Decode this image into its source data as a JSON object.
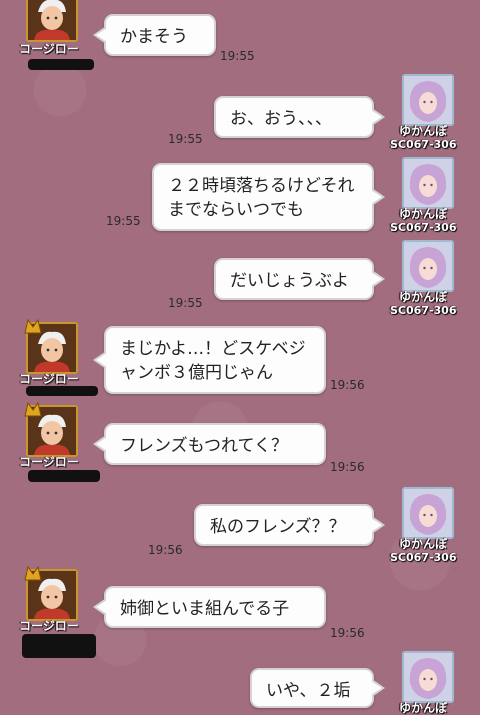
{
  "participants": {
    "kojiro": {
      "name": "コージロー"
    },
    "yukanbo": {
      "name": "ゆかんぼ",
      "code": "SC067-306"
    }
  },
  "messages": [
    {
      "sender": "kojiro",
      "text": "かまそう",
      "time": "19:55"
    },
    {
      "sender": "yukanbo",
      "text": "お、おう、、、",
      "time": "19:55"
    },
    {
      "sender": "yukanbo",
      "text": "２２時頃落ちるけどそれまでならいつでも",
      "time": "19:55"
    },
    {
      "sender": "yukanbo",
      "text": "だいじょうぶよ",
      "time": "19:55"
    },
    {
      "sender": "kojiro",
      "text": "まじかよ…！どスケベジャンボ３億円じゃん",
      "time": "19:56"
    },
    {
      "sender": "kojiro",
      "text": "フレンズもつれてく？",
      "time": "19:56"
    },
    {
      "sender": "yukanbo",
      "text": "私のフレンズ？？",
      "time": "19:56"
    },
    {
      "sender": "kojiro",
      "text": "姉御といま組んでる子",
      "time": "19:56"
    },
    {
      "sender": "yukanbo",
      "text": "いや、２垢",
      "time": ""
    }
  ],
  "colors": {
    "background": "#a26d7e",
    "bubble": "#fdfdfd",
    "kojiro_frame": "#c8962a",
    "yukanbo_frame": "#9fb9cf"
  },
  "icons": {
    "kojiro_avatar": "warrior-portrait",
    "yukanbo_avatar": "lavender-hair-portrait",
    "rank_badge": "gold-rank-badge"
  }
}
